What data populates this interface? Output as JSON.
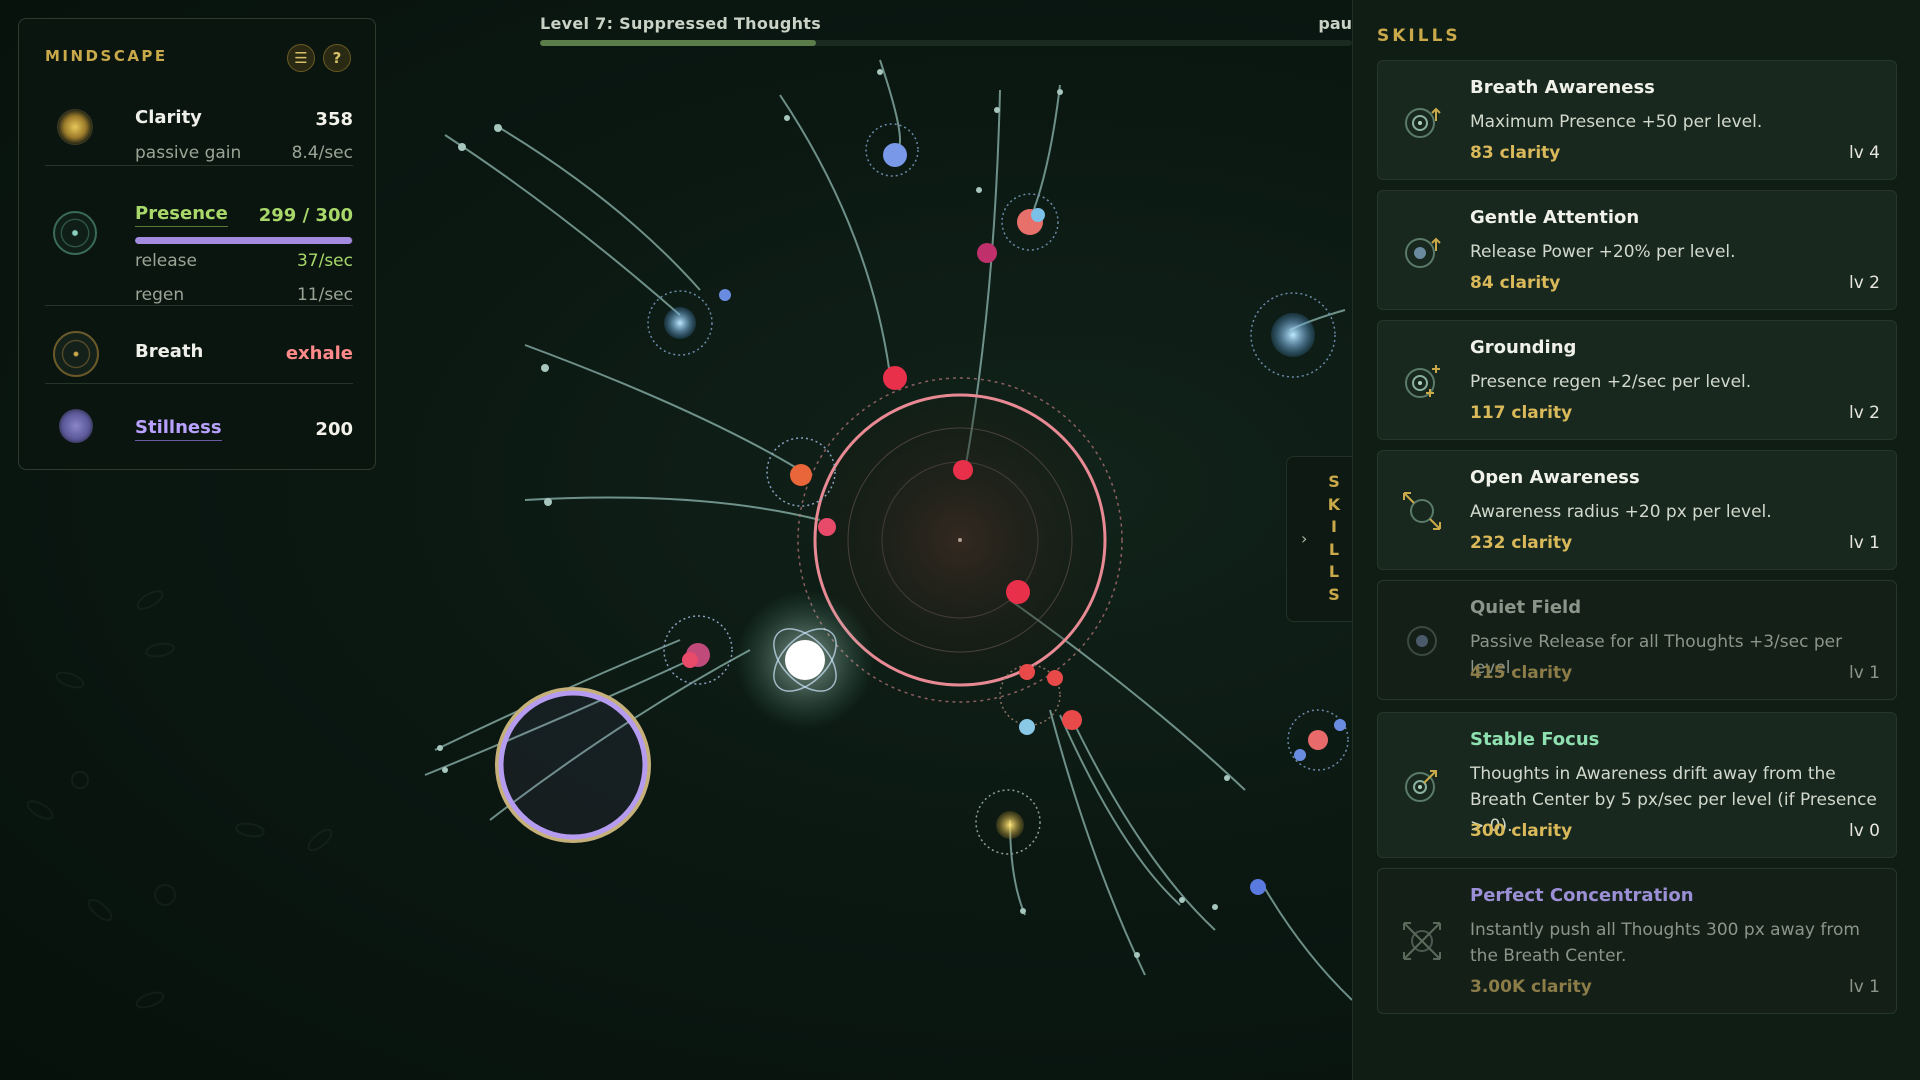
{
  "level": {
    "title": "Level 7: Suppressed Thoughts",
    "progress": 0.34,
    "pause_label": "pau"
  },
  "mindscape": {
    "title": "MINDSCAPE",
    "menu_icon": "menu-icon",
    "help_label": "?",
    "clarity": {
      "label": "Clarity",
      "value": "358",
      "sub_label": "passive gain",
      "sub_value": "8.4/sec"
    },
    "presence": {
      "label": "Presence",
      "value": "299 / 300",
      "fill": 0.997,
      "release_label": "release",
      "release_value": "37/sec",
      "regen_label": "regen",
      "regen_value": "11/sec"
    },
    "breath": {
      "label": "Breath",
      "value": "exhale"
    },
    "stillness": {
      "label": "Stillness",
      "value": "200"
    }
  },
  "skills_tab": {
    "label": "SKILLS",
    "chevron": "›"
  },
  "skills": {
    "title": "SKILLS",
    "items": [
      {
        "name": "Breath Awareness",
        "desc": "Maximum Presence +50 per level.",
        "cost": "83 clarity",
        "level": "lv 4",
        "icon": "breath-awareness-icon"
      },
      {
        "name": "Gentle Attention",
        "desc": "Release Power +20% per level.",
        "cost": "84 clarity",
        "level": "lv 2",
        "icon": "gentle-attention-icon"
      },
      {
        "name": "Grounding",
        "desc": "Presence regen +2/sec per level.",
        "cost": "117 clarity",
        "level": "lv 2",
        "icon": "grounding-icon"
      },
      {
        "name": "Open Awareness",
        "desc": "Awareness radius +20 px per level.",
        "cost": "232 clarity",
        "level": "lv 1",
        "icon": "open-awareness-icon"
      },
      {
        "name": "Quiet Field",
        "desc": "Passive Release for all Thoughts +3/sec per level.",
        "cost": "415 clarity",
        "level": "lv 1",
        "icon": "quiet-field-icon"
      },
      {
        "name": "Stable Focus",
        "desc": "Thoughts in Awareness drift away from the Breath Center by 5 px/sec per level (if Presence > 0).",
        "cost": "300 clarity",
        "level": "lv 0",
        "icon": "stable-focus-icon"
      },
      {
        "name": "Perfect Concentration",
        "desc": "Instantly push all Thoughts 300 px away from the Breath Center.",
        "cost": "3.00K clarity",
        "level": "lv 1",
        "icon": "perfect-concentration-icon"
      }
    ]
  },
  "colors": {
    "gold": "#c9a94a",
    "presence": "#a8d86a",
    "presence_bar": "#a38be0",
    "breath_exhale": "#ff8a8a",
    "stillness": "#b9a2ff",
    "stable_focus": "#8fe0b0",
    "perfect_concentration": "#9b8fd6",
    "breath_ring": "#e88a94",
    "awareness_ring": "#b59cf0"
  }
}
